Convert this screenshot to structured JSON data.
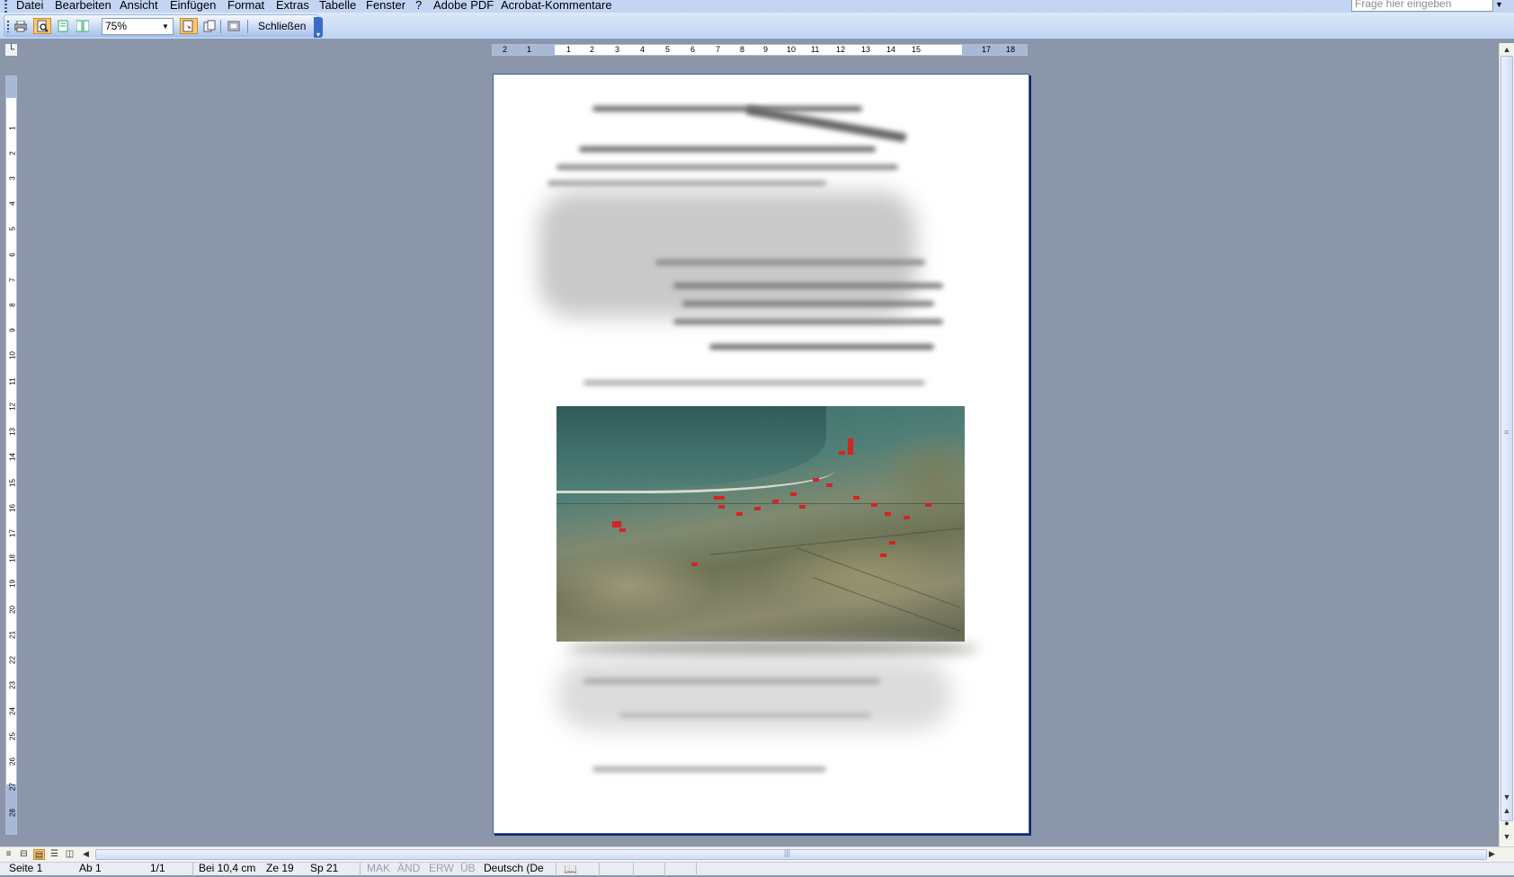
{
  "menu": {
    "items": [
      "Datei",
      "Bearbeiten",
      "Ansicht",
      "Einfügen",
      "Format",
      "Extras",
      "Tabelle",
      "Fenster",
      "?",
      "Adobe PDF",
      "Acrobat-Kommentare"
    ],
    "question_placeholder": "Frage hier eingeben"
  },
  "toolbar": {
    "zoom_value": "75%",
    "close_label": "Schließen"
  },
  "ruler": {
    "horizontal_numbers": [
      "2",
      "1",
      "1",
      "1",
      "2",
      "3",
      "4",
      "5",
      "6",
      "7",
      "8",
      "9",
      "10",
      "11",
      "12",
      "13",
      "14",
      "15",
      "17",
      "18"
    ],
    "vertical_numbers": [
      "1",
      "2",
      "3",
      "4",
      "5",
      "6",
      "7",
      "8",
      "9",
      "10",
      "11",
      "12",
      "13",
      "14",
      "15",
      "16",
      "17",
      "18",
      "19",
      "20",
      "21",
      "22",
      "23",
      "24",
      "25",
      "26",
      "27",
      "28"
    ]
  },
  "statusbar": {
    "page": "Seite 1",
    "section": "Ab 1",
    "pages": "1/1",
    "position": "Bei 10,4 cm",
    "line": "Ze 19",
    "column": "Sp 21",
    "mak": "MAK",
    "and": "ÄND",
    "erw": "ERW",
    "ub": "ÜB",
    "language": "Deutsch (De"
  },
  "icons": [
    "print-icon",
    "preview-icon",
    "one-page-icon",
    "multiple-pages-icon",
    "magnifier-icon",
    "shrink-to-fit-icon",
    "fullscreen-icon",
    "spelling-book-icon"
  ],
  "colors": {
    "workspace": "#8c96aa",
    "menubar": "#c3d5f3",
    "active_button": "#ffc870"
  }
}
